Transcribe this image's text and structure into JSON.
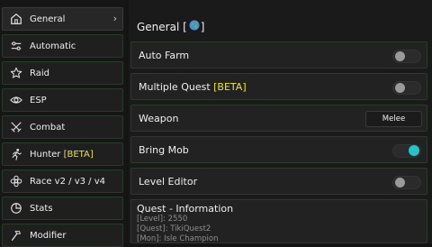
{
  "sidebar": {
    "items": [
      {
        "label": "General",
        "icon": "home-icon"
      },
      {
        "label": "Automatic",
        "icon": "sliders-icon"
      },
      {
        "label": "Raid",
        "icon": "star-icon"
      },
      {
        "label": "ESP",
        "icon": "eye-icon"
      },
      {
        "label": "Combat",
        "icon": "swords-icon"
      },
      {
        "label": "Hunter ",
        "beta": "[BETA]",
        "icon": "run-icon"
      },
      {
        "label": "Race v2 / v3 / v4",
        "icon": "flower-icon"
      },
      {
        "label": "Stats",
        "icon": "chart-icon"
      },
      {
        "label": "Modifier",
        "icon": "hammer-icon"
      }
    ],
    "chevron": "›"
  },
  "main": {
    "title": "General [",
    "title_end": "]",
    "rows": {
      "auto_farm": {
        "label": "Auto Farm",
        "state": "off"
      },
      "multiple_quest": {
        "label": "Multiple Quest ",
        "beta": "[BETA]",
        "state": "off"
      },
      "weapon": {
        "label": "Weapon",
        "value": "Melee"
      },
      "bring_mob": {
        "label": "Bring Mob",
        "state": "on"
      },
      "level_editor": {
        "label": "Level Editor",
        "state": "off"
      }
    },
    "quest": {
      "heading": "Quest - Information",
      "lines": [
        "[Level]: 2550",
        "[Quest]: TikiQuest2",
        "[Mon]: Isle Champion"
      ]
    }
  },
  "colors": {
    "accent": "#22c6c9",
    "beta": "#e8e43a"
  }
}
